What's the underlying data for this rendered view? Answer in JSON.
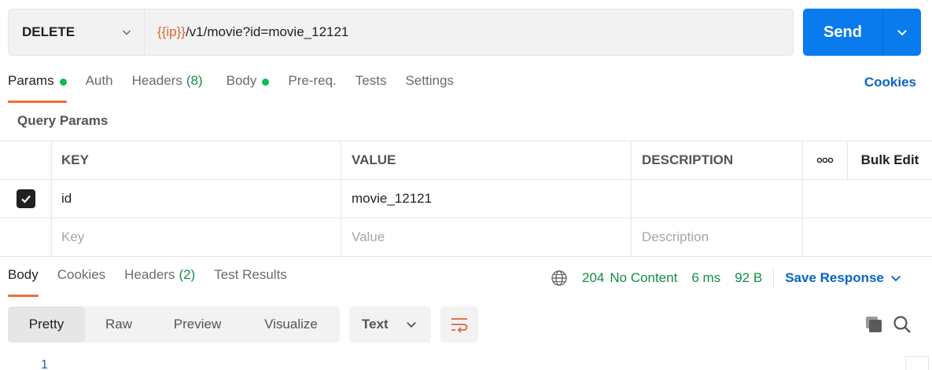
{
  "request": {
    "method": "DELETE",
    "url_var": "{{ip}}",
    "url_path": "/v1/movie?id=movie_12121",
    "send_label": "Send"
  },
  "request_tabs": [
    {
      "label": "Params",
      "dot": true,
      "active": true
    },
    {
      "label": "Auth"
    },
    {
      "label": "Headers",
      "count": "(8)"
    },
    {
      "label": "Body",
      "dot": true
    },
    {
      "label": "Pre-req."
    },
    {
      "label": "Tests"
    },
    {
      "label": "Settings"
    }
  ],
  "cookies_link": "Cookies",
  "query_params": {
    "title": "Query Params",
    "columns": [
      "KEY",
      "VALUE",
      "DESCRIPTION"
    ],
    "more_label": "ooo",
    "bulk_edit": "Bulk Edit",
    "rows": [
      {
        "checked": true,
        "key": "id",
        "value": "movie_12121",
        "description": ""
      }
    ],
    "placeholder": {
      "key": "Key",
      "value": "Value",
      "description": "Description"
    }
  },
  "response_tabs": [
    {
      "label": "Body",
      "active": true
    },
    {
      "label": "Cookies"
    },
    {
      "label": "Headers",
      "count": "(2)"
    },
    {
      "label": "Test Results"
    }
  ],
  "response_status": {
    "code": "204",
    "text": "No Content",
    "time": "6 ms",
    "size": "92 B",
    "save_label": "Save Response"
  },
  "view_modes": [
    "Pretty",
    "Raw",
    "Preview",
    "Visualize"
  ],
  "active_view": "Pretty",
  "format": "Text",
  "line_number": "1",
  "colors": {
    "accent": "#097bed",
    "link": "#0a65c2",
    "active_tab_underline": "#f26b3a",
    "status_green": "#0f8f43",
    "variable": "#e06236"
  }
}
